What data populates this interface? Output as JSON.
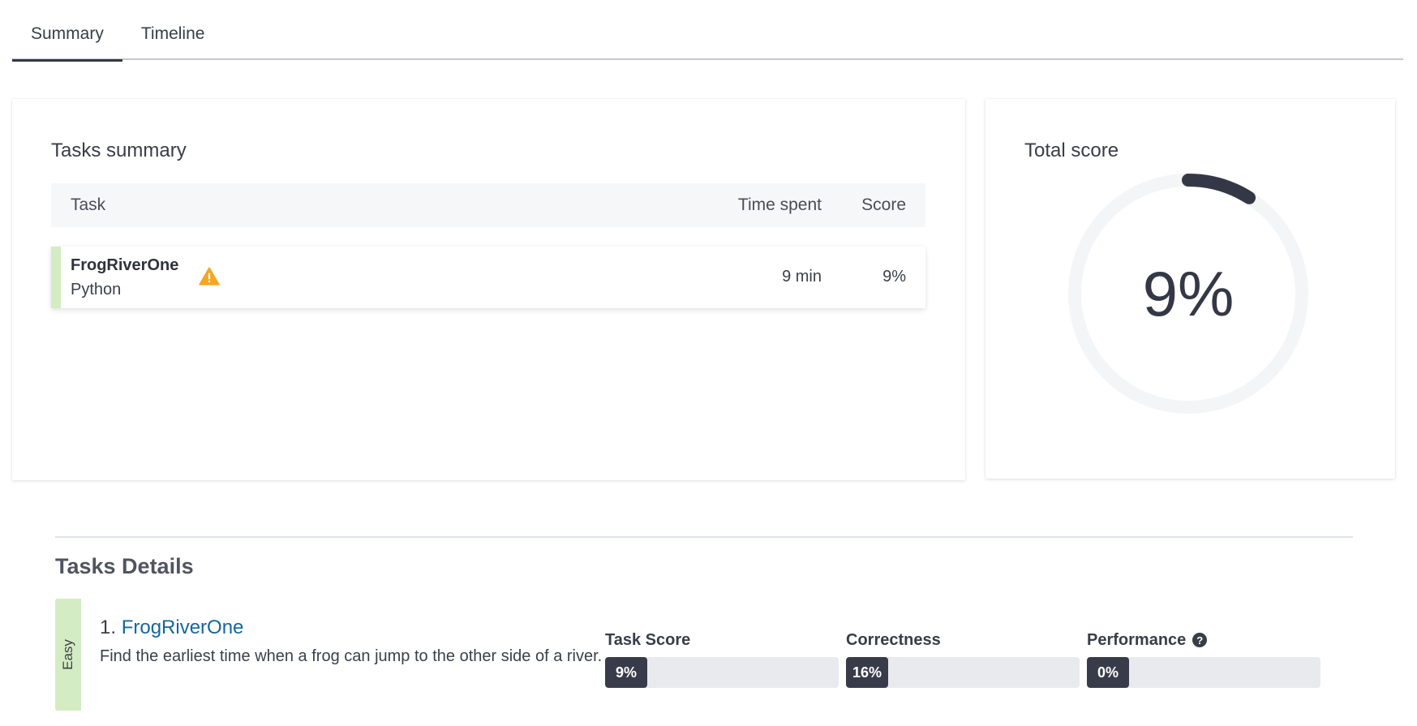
{
  "tabs": [
    {
      "label": "Summary",
      "active": true
    },
    {
      "label": "Timeline",
      "active": false
    }
  ],
  "summary": {
    "title": "Tasks summary",
    "columns": {
      "task": "Task",
      "time": "Time spent",
      "score": "Score"
    },
    "rows": [
      {
        "name": "FrogRiverOne",
        "language": "Python",
        "warning_icon": "warning-triangle-icon",
        "time": "9 min",
        "score": "9%"
      }
    ]
  },
  "total": {
    "title": "Total score",
    "value_label": "9%",
    "value": 0.09
  },
  "details": {
    "title": "Tasks Details",
    "tasks": [
      {
        "difficulty": "Easy",
        "number": "1.",
        "name": "FrogRiverOne",
        "description": "Find the earliest time when a frog can jump to the other side of a river.",
        "metrics": {
          "task_score": {
            "label": "Task Score",
            "value_label": "9%",
            "value": 0.09
          },
          "correctness": {
            "label": "Correctness",
            "value_label": "16%",
            "value": 0.16
          },
          "performance": {
            "label": "Performance",
            "value_label": "0%",
            "value": 0.0,
            "help_icon": "question-circle-icon",
            "help_glyph": "?"
          }
        }
      }
    ]
  },
  "colors": {
    "accent_dark": "#343846",
    "easy_green": "#d4ecc3",
    "link_blue": "#14679f",
    "warning_orange": "#f5a623"
  }
}
